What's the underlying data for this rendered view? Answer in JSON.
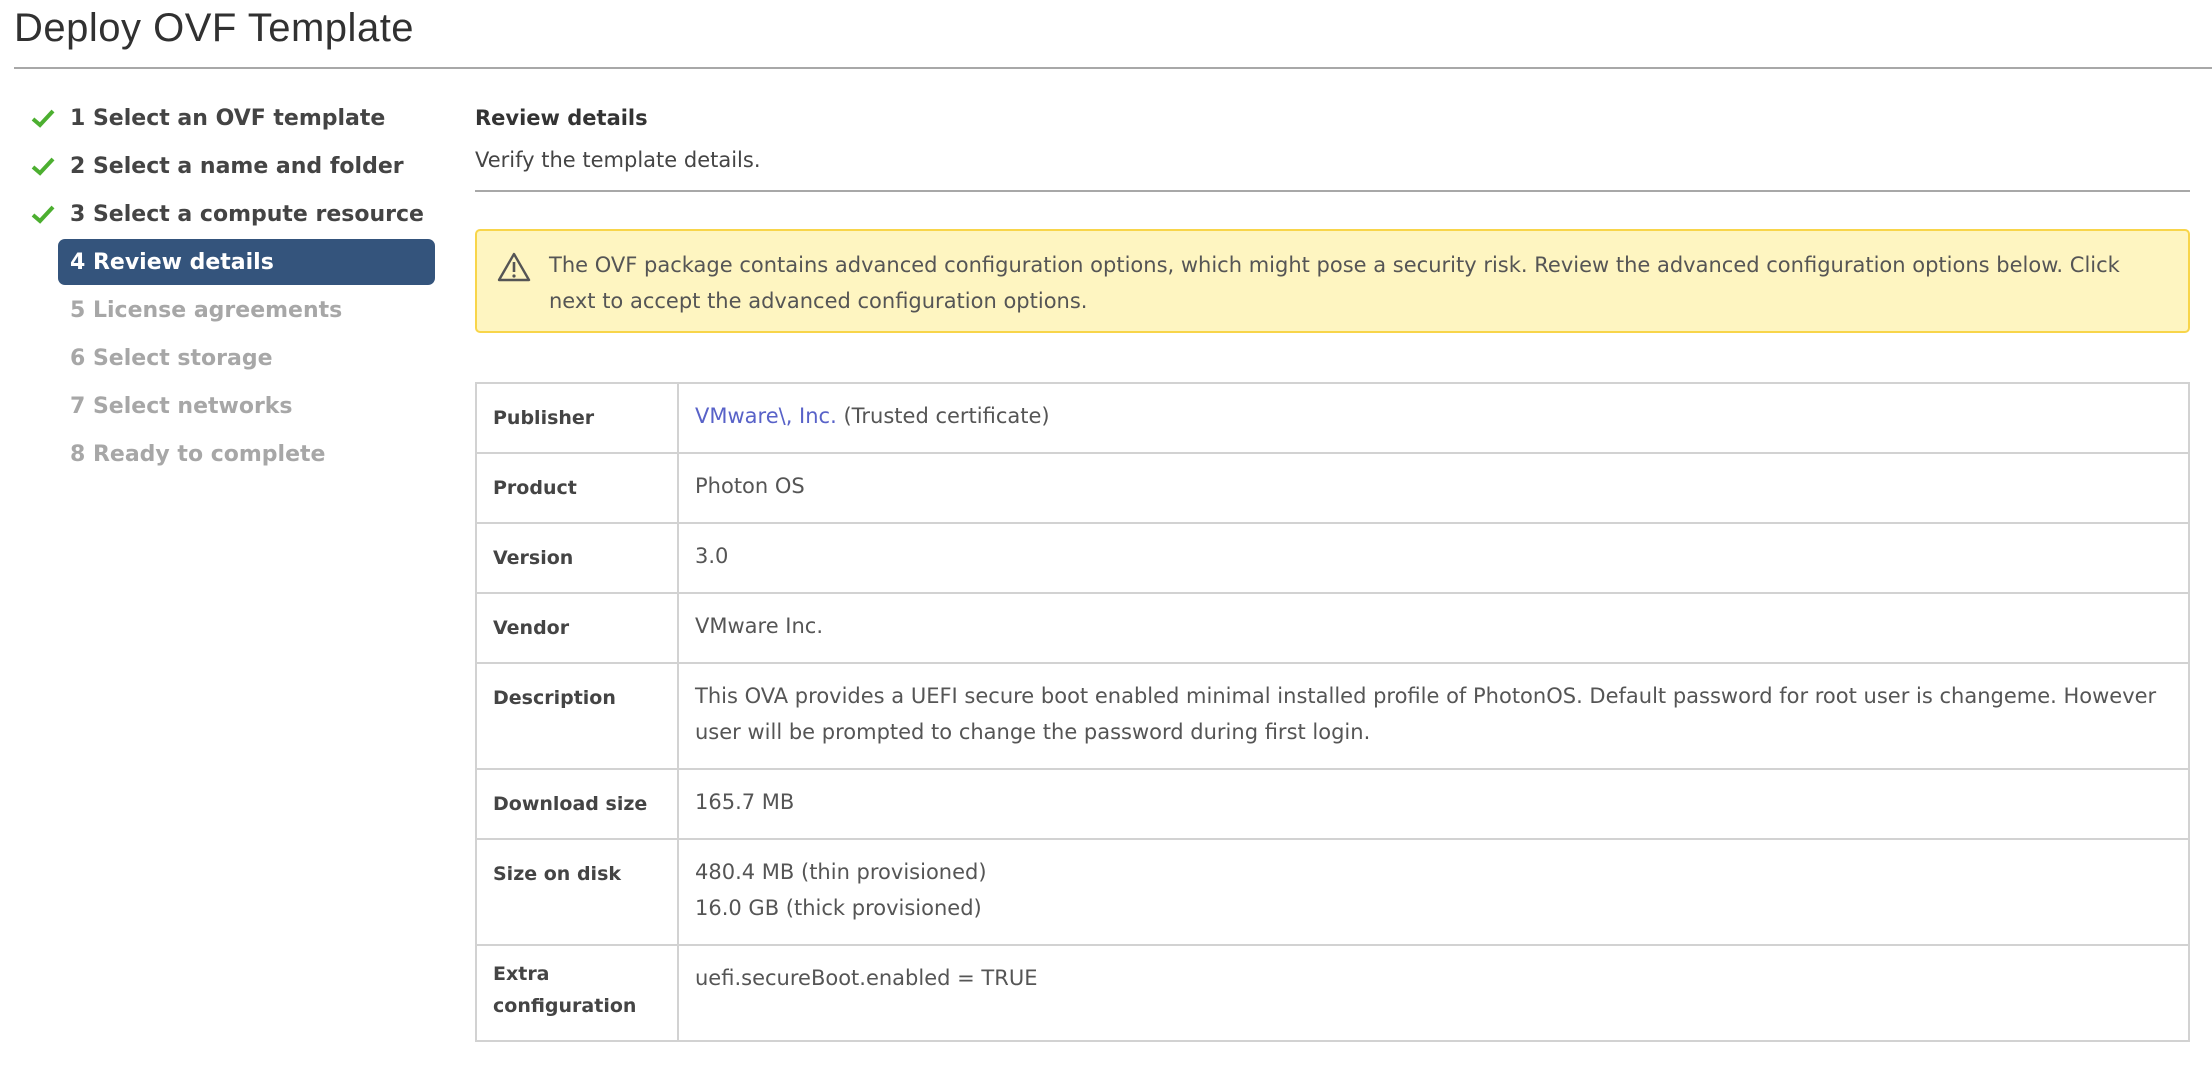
{
  "title": "Deploy OVF Template",
  "steps": [
    {
      "label": "1 Select an OVF template",
      "status": "done"
    },
    {
      "label": "2 Select a name and folder",
      "status": "done"
    },
    {
      "label": "3 Select a compute resource",
      "status": "done"
    },
    {
      "label": "4 Review details",
      "status": "active"
    },
    {
      "label": "5 License agreements",
      "status": "pending"
    },
    {
      "label": "6 Select storage",
      "status": "pending"
    },
    {
      "label": "7 Select networks",
      "status": "pending"
    },
    {
      "label": "8 Ready to complete",
      "status": "pending"
    }
  ],
  "main": {
    "heading": "Review details",
    "subheading": "Verify the template details.",
    "warning": "The OVF package contains advanced configuration options, which might pose a security risk. Review the advanced configuration options below. Click next to accept the advanced configuration options.",
    "details": {
      "publisher_label": "Publisher",
      "publisher_link": "VMware\\, Inc.",
      "publisher_note": "(Trusted certificate)",
      "product_label": "Product",
      "product": "Photon OS",
      "version_label": "Version",
      "version": "3.0",
      "vendor_label": "Vendor",
      "vendor": "VMware Inc.",
      "description_label": "Description",
      "description": "This OVA provides a UEFI secure boot enabled minimal installed profile of PhotonOS. Default password for root user is changeme. However user will be prompted to change the password during first login.",
      "download_label": "Download size",
      "download": "165.7 MB",
      "disk_label": "Size on disk",
      "disk_thin": "480.4 MB (thin provisioned)",
      "disk_thick": "16.0 GB (thick provisioned)",
      "extra_label": "Extra configuration",
      "extra": "uefi.secureBoot.enabled = TRUE"
    }
  },
  "colors": {
    "accent": "#34547c",
    "check": "#4caf30",
    "warning_bg": "#fef5c1",
    "link": "#5862c8"
  }
}
